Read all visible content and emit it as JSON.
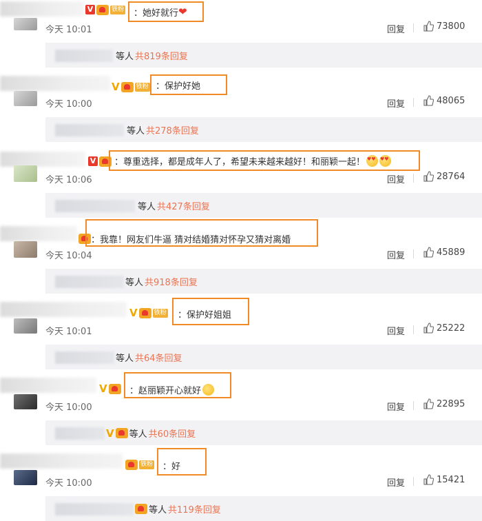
{
  "comments": [
    {
      "text": "：她好就行",
      "suffix": "heart",
      "time": "今天 10:01",
      "reply": "回复",
      "likes": "73800",
      "sub_people": "等人",
      "sub_count": "共819条回复",
      "fan_label": "铁粉"
    },
    {
      "text": "：保护好她",
      "suffix": "",
      "time": "今天 10:00",
      "reply": "回复",
      "likes": "48065",
      "sub_people": "等人",
      "sub_count": "共278条回复",
      "fan_label": "铁粉"
    },
    {
      "text": "：尊重选择，都是成年人了，希望未来越来越好！和丽颖一起！",
      "suffix": "love2",
      "time": "今天 10:06",
      "reply": "回复",
      "likes": "28764",
      "sub_people": "等人",
      "sub_count": "共427条回复"
    },
    {
      "text": "：我靠！网友们牛逼 猜对结婚猜对怀孕又猜对离婚",
      "suffix": "",
      "time": "今天 10:04",
      "reply": "回复",
      "likes": "45889",
      "sub_people": "等人",
      "sub_count": "共918条回复"
    },
    {
      "text": "：保护好姐姐",
      "suffix": "",
      "time": "今天 10:01",
      "reply": "回复",
      "likes": "25222",
      "sub_people": "等人",
      "sub_count": "共64条回复",
      "fan_label": "铁粉"
    },
    {
      "text": "：赵丽颖开心就好",
      "suffix": "smile",
      "time": "今天 10:00",
      "reply": "回复",
      "likes": "22895",
      "sub_people": "等人",
      "sub_count": "共60条回复"
    },
    {
      "text": "：好",
      "suffix": "",
      "time": "今天 10:00",
      "reply": "回复",
      "likes": "15421",
      "sub_people": "等人",
      "sub_count": "共119条回复",
      "fan_label": "铁粉"
    }
  ],
  "colors": {
    "highlight_border": "#f08a24",
    "count_link": "#eb7350",
    "verified": "#f0a800",
    "subbar_bg": "#f2f2f5"
  },
  "icons": {
    "like": "thumbs-up-icon",
    "verified": "v-badge-icon",
    "fan": "fan-badge-icon"
  }
}
